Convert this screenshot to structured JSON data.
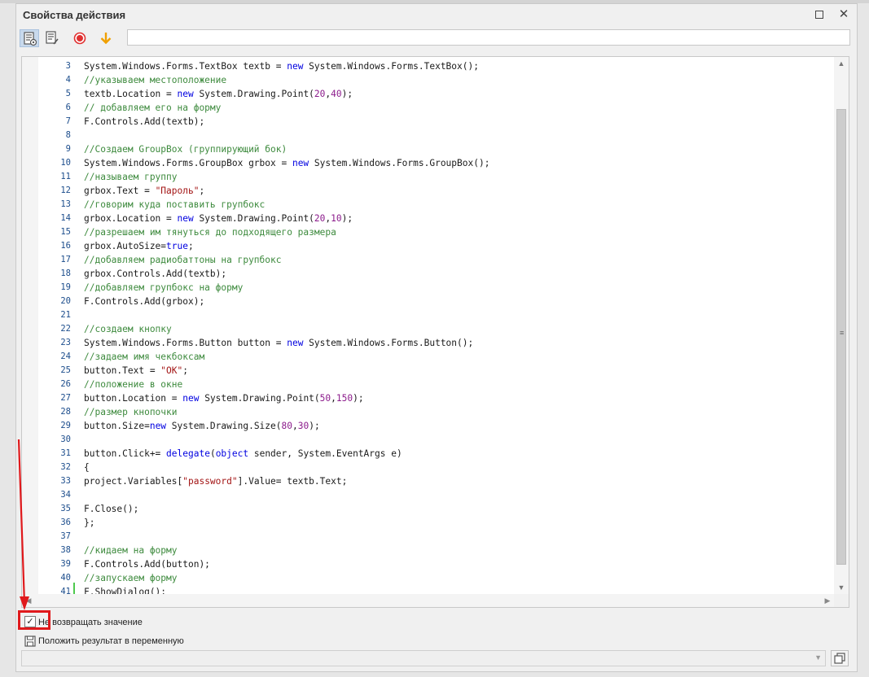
{
  "window": {
    "title": "Свойства действия"
  },
  "toolbar": {
    "icons": [
      "code-edit-icon",
      "code-format-icon",
      "record-icon",
      "arrow-down-icon"
    ],
    "input_value": ""
  },
  "editor": {
    "lines": [
      {
        "n": "3",
        "parts": [
          [
            "plain",
            "System.Windows.Forms.TextBox textb = "
          ],
          [
            "kw",
            "new"
          ],
          [
            "plain",
            " System.Windows.Forms.TextBox();"
          ]
        ]
      },
      {
        "n": "4",
        "parts": [
          [
            "comment",
            "//указываем местоположение"
          ]
        ]
      },
      {
        "n": "5",
        "parts": [
          [
            "plain",
            "textb.Location = "
          ],
          [
            "kw",
            "new"
          ],
          [
            "plain",
            " System.Drawing.Point("
          ],
          [
            "num",
            "20"
          ],
          [
            "plain",
            ","
          ],
          [
            "num",
            "40"
          ],
          [
            "plain",
            ");"
          ]
        ]
      },
      {
        "n": "6",
        "parts": [
          [
            "comment",
            "// добавляем его на форму"
          ]
        ]
      },
      {
        "n": "7",
        "parts": [
          [
            "plain",
            "F.Controls.Add(textb);"
          ]
        ]
      },
      {
        "n": "8",
        "parts": []
      },
      {
        "n": "9",
        "parts": [
          [
            "comment",
            "//Создаем GroupBox (группирующий бок)"
          ]
        ]
      },
      {
        "n": "10",
        "parts": [
          [
            "plain",
            "System.Windows.Forms.GroupBox grbox = "
          ],
          [
            "kw",
            "new"
          ],
          [
            "plain",
            " System.Windows.Forms.GroupBox();"
          ]
        ]
      },
      {
        "n": "11",
        "parts": [
          [
            "comment",
            "//называем группу"
          ]
        ]
      },
      {
        "n": "12",
        "parts": [
          [
            "plain",
            "grbox.Text = "
          ],
          [
            "string",
            "\"Пароль\""
          ],
          [
            "plain",
            ";"
          ]
        ]
      },
      {
        "n": "13",
        "parts": [
          [
            "comment",
            "//говорим куда поставить групбокс"
          ]
        ]
      },
      {
        "n": "14",
        "parts": [
          [
            "plain",
            "grbox.Location = "
          ],
          [
            "kw",
            "new"
          ],
          [
            "plain",
            " System.Drawing.Point("
          ],
          [
            "num",
            "20"
          ],
          [
            "plain",
            ","
          ],
          [
            "num",
            "10"
          ],
          [
            "plain",
            ");"
          ]
        ]
      },
      {
        "n": "15",
        "parts": [
          [
            "comment",
            "//разрешаем им тянуться до подходящего размера"
          ]
        ]
      },
      {
        "n": "16",
        "parts": [
          [
            "plain",
            "grbox.AutoSize="
          ],
          [
            "kw",
            "true"
          ],
          [
            "plain",
            ";"
          ]
        ]
      },
      {
        "n": "17",
        "parts": [
          [
            "comment",
            "//добавляем радиобаттоны на групбокс"
          ]
        ]
      },
      {
        "n": "18",
        "parts": [
          [
            "plain",
            "grbox.Controls.Add(textb);"
          ]
        ]
      },
      {
        "n": "19",
        "parts": [
          [
            "comment",
            "//добавляем групбокс на форму"
          ]
        ]
      },
      {
        "n": "20",
        "parts": [
          [
            "plain",
            "F.Controls.Add(grbox);"
          ]
        ]
      },
      {
        "n": "21",
        "parts": []
      },
      {
        "n": "22",
        "parts": [
          [
            "comment",
            "//создаем кнопку"
          ]
        ]
      },
      {
        "n": "23",
        "parts": [
          [
            "plain",
            "System.Windows.Forms.Button button = "
          ],
          [
            "kw",
            "new"
          ],
          [
            "plain",
            " System.Windows.Forms.Button();"
          ]
        ]
      },
      {
        "n": "24",
        "parts": [
          [
            "comment",
            "//задаем имя чекбоксам"
          ]
        ]
      },
      {
        "n": "25",
        "parts": [
          [
            "plain",
            "button.Text = "
          ],
          [
            "string",
            "\"OK\""
          ],
          [
            "plain",
            ";"
          ]
        ]
      },
      {
        "n": "26",
        "parts": [
          [
            "comment",
            "//положение в окне"
          ]
        ]
      },
      {
        "n": "27",
        "parts": [
          [
            "plain",
            "button.Location = "
          ],
          [
            "kw",
            "new"
          ],
          [
            "plain",
            " System.Drawing.Point("
          ],
          [
            "num",
            "50"
          ],
          [
            "plain",
            ","
          ],
          [
            "num",
            "150"
          ],
          [
            "plain",
            ");"
          ]
        ]
      },
      {
        "n": "28",
        "parts": [
          [
            "comment",
            "//размер кнопочки"
          ]
        ]
      },
      {
        "n": "29",
        "parts": [
          [
            "plain",
            "button.Size="
          ],
          [
            "kw",
            "new"
          ],
          [
            "plain",
            " System.Drawing.Size("
          ],
          [
            "num",
            "80"
          ],
          [
            "plain",
            ","
          ],
          [
            "num",
            "30"
          ],
          [
            "plain",
            ");"
          ]
        ]
      },
      {
        "n": "30",
        "parts": []
      },
      {
        "n": "31",
        "parts": [
          [
            "plain",
            "button.Click+= "
          ],
          [
            "kw",
            "delegate"
          ],
          [
            "plain",
            "("
          ],
          [
            "kw",
            "object"
          ],
          [
            "plain",
            " sender, System.EventArgs e)"
          ]
        ]
      },
      {
        "n": "32",
        "parts": [
          [
            "plain",
            "{"
          ]
        ]
      },
      {
        "n": "33",
        "parts": [
          [
            "plain",
            "project.Variables["
          ],
          [
            "string",
            "\"password\""
          ],
          [
            "plain",
            "].Value= textb.Text;"
          ]
        ]
      },
      {
        "n": "34",
        "parts": []
      },
      {
        "n": "35",
        "parts": [
          [
            "plain",
            "F.Close();"
          ]
        ]
      },
      {
        "n": "36",
        "parts": [
          [
            "plain",
            "};"
          ]
        ]
      },
      {
        "n": "37",
        "parts": []
      },
      {
        "n": "38",
        "parts": [
          [
            "comment",
            "//кидаем на форму"
          ]
        ]
      },
      {
        "n": "39",
        "parts": [
          [
            "plain",
            "F.Controls.Add(button);"
          ]
        ]
      },
      {
        "n": "40",
        "parts": [
          [
            "comment",
            "//запускаем форму"
          ]
        ]
      },
      {
        "n": "41",
        "parts": [
          [
            "plain",
            "F.ShowDialog();"
          ]
        ]
      }
    ]
  },
  "options": {
    "no_return_label": "Не возвращать значение",
    "no_return_checked": true,
    "no_return_check_glyph": "✓",
    "put_result_label": "Положить результат в переменную"
  },
  "result_field": {
    "value": ""
  },
  "colors": {
    "comment": "#3d8a3d",
    "keyword": "#0000e0",
    "string": "#a31515",
    "number": "#8c1c8c",
    "line_number": "#1c4d8c",
    "annotation": "#e0191c"
  }
}
